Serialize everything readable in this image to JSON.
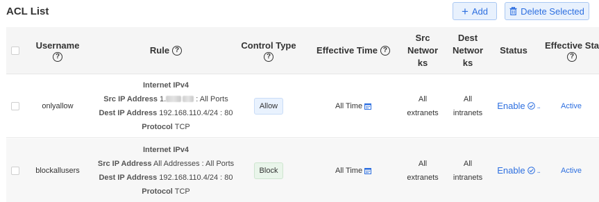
{
  "page": {
    "title": "ACL List",
    "add_label": "Add",
    "delete_label": "Delete Selected"
  },
  "columns": {
    "username_line1": "Username",
    "rule": "Rule",
    "control_type_line1": "Control Type",
    "effective_time": "Effective Time",
    "src_networks": [
      "Src",
      "Networ",
      "ks"
    ],
    "dest_networks": [
      "Dest",
      "Networ",
      "ks"
    ],
    "status": "Status",
    "effective_status": "Effective Sta"
  },
  "rows": [
    {
      "username": "onlyallow",
      "rule": {
        "internet_label": "Internet IPv4",
        "src_label": "Src IP Address",
        "src_value_prefix": "1.",
        "src_value_suffix": ": All Ports",
        "dest_label": "Dest IP Address",
        "dest_value": "192.168.110.4/24 : 80",
        "protocol_label": "Protocol",
        "protocol_value": "TCP"
      },
      "control_type": "Allow",
      "effective_time": "All Time",
      "src_networks": [
        "All",
        "extranets"
      ],
      "dest_networks": [
        "All",
        "intranets"
      ],
      "status": "Enable",
      "status_more": "..",
      "effective_status": "Active"
    },
    {
      "username": "blockallusers",
      "rule": {
        "internet_label": "Internet IPv4",
        "src_label": "Src IP Address",
        "src_value": "All Addresses : All Ports",
        "dest_label": "Dest IP Address",
        "dest_value": "192.168.110.4/24 : 80",
        "protocol_label": "Protocol",
        "protocol_value": "TCP"
      },
      "control_type": "Block",
      "effective_time": "All Time",
      "src_networks": [
        "All",
        "extranets"
      ],
      "dest_networks": [
        "All",
        "intranets"
      ],
      "status": "Enable",
      "status_more": "..",
      "effective_status": "Active"
    }
  ],
  "icons": {
    "help": "?",
    "plus": "+"
  },
  "colors": {
    "accent": "#2d6fe0",
    "header_bg": "#f5f5f5",
    "allow_tag_bg": "#e9f2fe",
    "block_tag_bg": "#e9f5ea"
  }
}
